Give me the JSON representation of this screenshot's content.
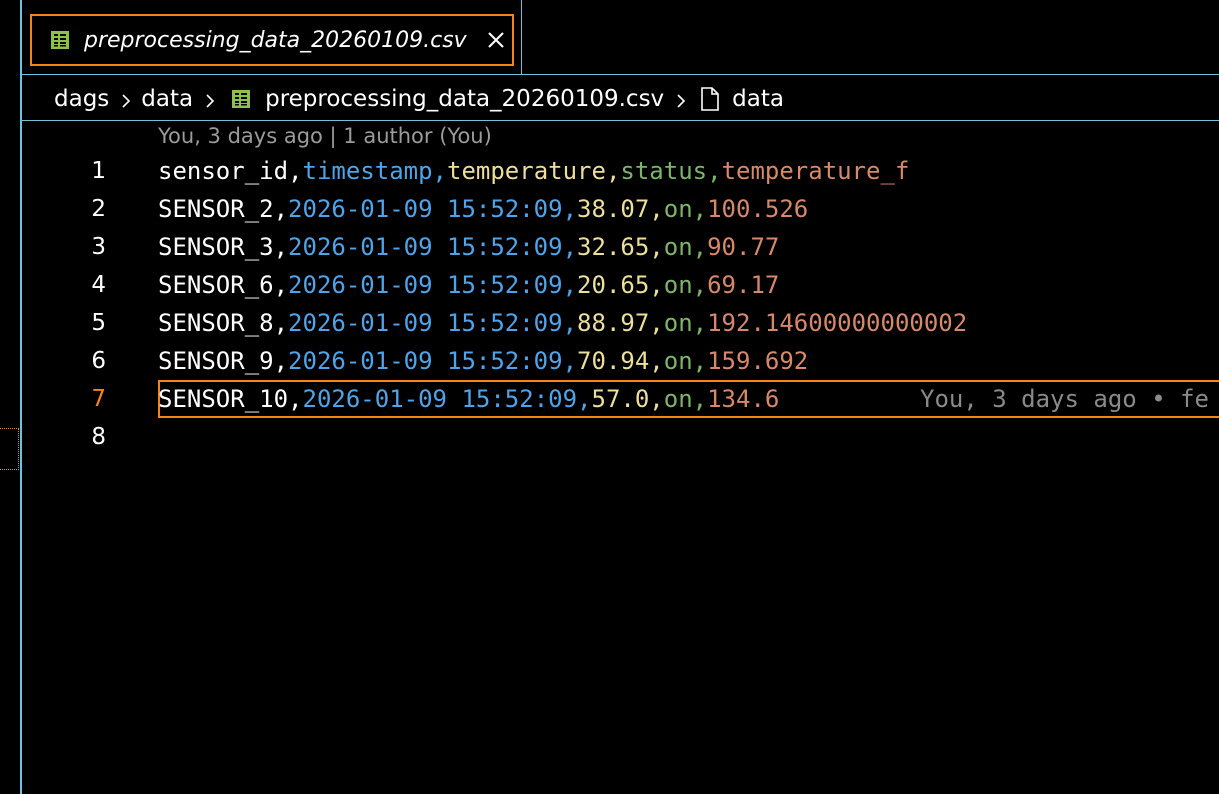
{
  "tab": {
    "title": "preprocessing_data_20260109.csv",
    "icon": "table-icon",
    "close_icon": "close-icon"
  },
  "breadcrumb": {
    "items": [
      "dags",
      "data",
      "preprocessing_data_20260109.csv",
      "data"
    ]
  },
  "editor": {
    "blame_header": "You, 3 days ago | 1 author (You)",
    "inline_blame": "You, 3 days ago • fe",
    "active_line": 7,
    "lines": [
      {
        "num": "1",
        "cells": [
          "sensor_id",
          "timestamp",
          "temperature",
          "status",
          "temperature_f"
        ]
      },
      {
        "num": "2",
        "cells": [
          "SENSOR_2",
          "2026-01-09 15:52:09",
          "38.07",
          "on",
          "100.526"
        ]
      },
      {
        "num": "3",
        "cells": [
          "SENSOR_3",
          "2026-01-09 15:52:09",
          "32.65",
          "on",
          "90.77"
        ]
      },
      {
        "num": "4",
        "cells": [
          "SENSOR_6",
          "2026-01-09 15:52:09",
          "20.65",
          "on",
          "69.17"
        ]
      },
      {
        "num": "5",
        "cells": [
          "SENSOR_8",
          "2026-01-09 15:52:09",
          "88.97",
          "on",
          "192.14600000000002"
        ]
      },
      {
        "num": "6",
        "cells": [
          "SENSOR_9",
          "2026-01-09 15:52:09",
          "70.94",
          "on",
          "159.692"
        ]
      },
      {
        "num": "7",
        "cells": [
          "SENSOR_10",
          "2026-01-09 15:52:09",
          "57.0",
          "on",
          "134.6"
        ]
      },
      {
        "num": "8",
        "cells": []
      }
    ]
  },
  "colors": {
    "border": "#6fc3df",
    "focus": "#f38518",
    "col_1": "#ffffff",
    "col_2": "#4fa3e8",
    "col_3": "#ecdf9a",
    "col_4": "#7eb46a",
    "col_5": "#d8886a"
  }
}
